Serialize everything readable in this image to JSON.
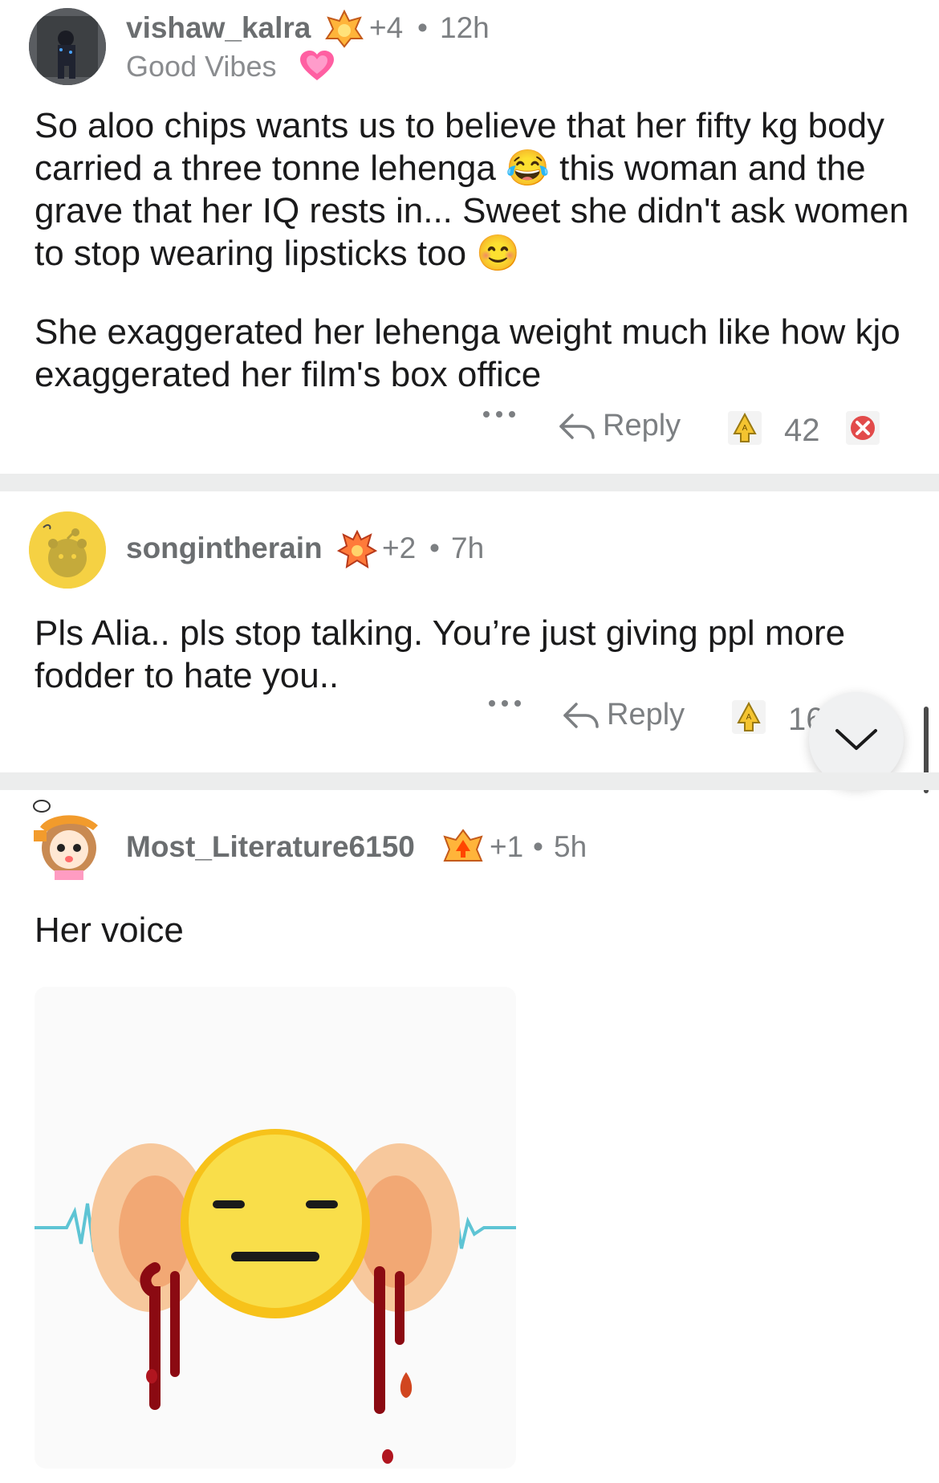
{
  "comments": [
    {
      "username": "vishaw_kalra",
      "awards": "+4",
      "time": "12h",
      "flair": "Good Vibes",
      "body": [
        "So aloo chips wants us to believe that her fifty kg body carried a three tonne lehenga 😂 this woman and the grave that her IQ rests in... Sweet she didn't ask women to stop wearing lipsticks too 😊",
        "She exaggerated her lehenga weight much like how kjo exaggerated her film's box office"
      ],
      "reply_label": "Reply",
      "votes": "42"
    },
    {
      "username": "songintherain",
      "awards": "+2",
      "time": "7h",
      "body": [
        "Pls Alia.. pls stop talking. You’re just giving ppl more fodder to hate you.."
      ],
      "reply_label": "Reply",
      "votes": "16"
    },
    {
      "username": "Most_Literature6150",
      "awards": "+1",
      "time": "5h",
      "body": [
        "Her voice"
      ]
    }
  ],
  "separator": "•",
  "more_icon": "more-dots-icon",
  "colors": {
    "divider": "#eceded",
    "meta": "#7c7f82",
    "avatar_yellow": "#f5d143"
  }
}
